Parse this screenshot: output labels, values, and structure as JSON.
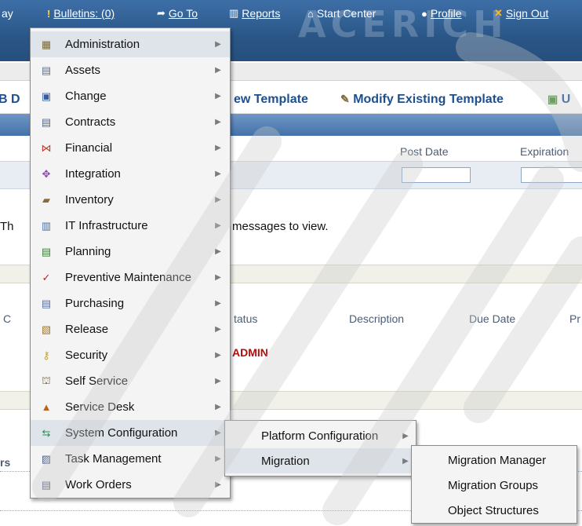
{
  "nav": {
    "partial_left": "ay",
    "bulletins": "Bulletins: (0)",
    "goto": "Go To",
    "reports": "Reports",
    "start_center": "Start Center",
    "profile": "Profile",
    "sign_out": "Sign Out"
  },
  "brand_watermark": "ACERICH",
  "toolbar": {
    "left_partial": "B D",
    "new_template_partial": "ew Template",
    "modify_template": "Modify Existing Template",
    "right_partial": "U"
  },
  "bulletin_board": {
    "post_date_header": "Post Date",
    "expiration_header": "Expiration",
    "message_left_partial": "Th",
    "message": "messages to view."
  },
  "inbox": {
    "left_partial": "C",
    "status_header": "tatus",
    "description_header": "Description",
    "due_date_header": "Due Date",
    "right_partial": "Pr",
    "row_value": "ADMIN",
    "bottom_left_partial": "rs"
  },
  "goto_menu": {
    "items": [
      {
        "label": "Administration",
        "icon": "admin-icon"
      },
      {
        "label": "Assets",
        "icon": "assets-icon"
      },
      {
        "label": "Change",
        "icon": "change-icon"
      },
      {
        "label": "Contracts",
        "icon": "contracts-icon"
      },
      {
        "label": "Financial",
        "icon": "financial-icon"
      },
      {
        "label": "Integration",
        "icon": "integration-icon"
      },
      {
        "label": "Inventory",
        "icon": "inventory-icon"
      },
      {
        "label": "IT Infrastructure",
        "icon": "it-infrastructure-icon"
      },
      {
        "label": "Planning",
        "icon": "planning-icon"
      },
      {
        "label": "Preventive Maintenance",
        "icon": "preventive-maintenance-icon"
      },
      {
        "label": "Purchasing",
        "icon": "purchasing-icon"
      },
      {
        "label": "Release",
        "icon": "release-icon"
      },
      {
        "label": "Security",
        "icon": "security-icon"
      },
      {
        "label": "Self Service",
        "icon": "self-service-icon"
      },
      {
        "label": "Service Desk",
        "icon": "service-desk-icon"
      },
      {
        "label": "System Configuration",
        "icon": "system-configuration-icon"
      },
      {
        "label": "Task Management",
        "icon": "task-management-icon"
      },
      {
        "label": "Work Orders",
        "icon": "work-orders-icon"
      }
    ]
  },
  "system_config_submenu": {
    "items": [
      {
        "label": "Platform Configuration"
      },
      {
        "label": "Migration"
      }
    ]
  },
  "migration_submenu": {
    "items": [
      {
        "label": "Migration Manager"
      },
      {
        "label": "Migration Groups"
      },
      {
        "label": "Object Structures"
      }
    ]
  },
  "colors": {
    "nav_bg": "#2a5687",
    "link_blue": "#1d4f8f",
    "admin_red": "#b10e0e",
    "menu_bg": "#f4f4f4"
  }
}
